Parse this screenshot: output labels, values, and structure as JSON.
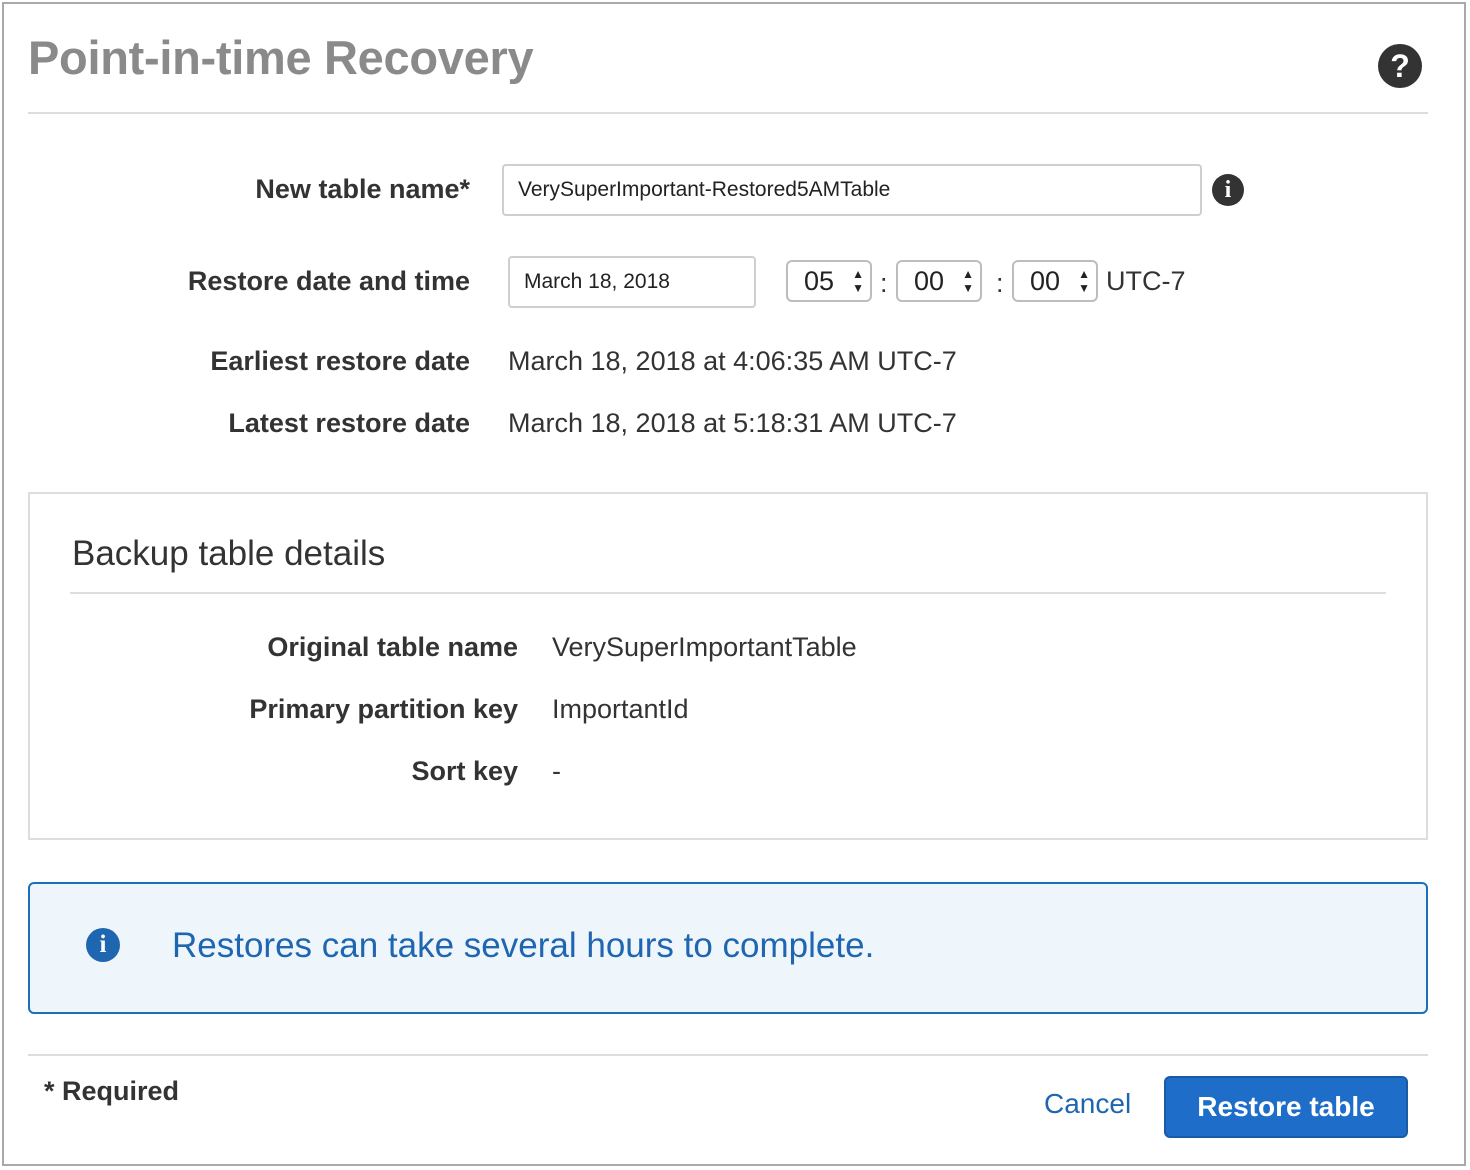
{
  "dialog": {
    "title": "Point-in-time Recovery",
    "help_icon": "question-circle-icon",
    "help_symbol": "?"
  },
  "form": {
    "table_name_label": "New table name*",
    "table_name_value": "VerySuperImportant-Restored5AMTable",
    "info_icon": "info-circle-icon",
    "info_symbol": "i",
    "restore_label": "Restore date and time",
    "restore_date": "March 18, 2018",
    "hour": "05",
    "minute": "00",
    "second": "00",
    "colon": ":",
    "timezone": "UTC-7",
    "earliest_label": "Earliest restore date",
    "earliest_value": "March 18, 2018 at 4:06:35 AM UTC-7",
    "latest_label": "Latest restore date",
    "latest_value": "March 18, 2018 at 5:18:31 AM UTC-7"
  },
  "backup": {
    "title": "Backup table details",
    "original_label": "Original table name",
    "original_value": "VerySuperImportantTable",
    "partition_label": "Primary partition key",
    "partition_value": "ImportantId",
    "sort_label": "Sort key",
    "sort_value": "-"
  },
  "alert": {
    "icon": "info-circle-icon",
    "icon_symbol": "i",
    "message": "Restores can take several hours to complete.",
    "color": "#1f66b0"
  },
  "footer": {
    "required": "* Required",
    "cancel": "Cancel",
    "restore": "Restore table",
    "primary_color": "#1e6ec9"
  }
}
